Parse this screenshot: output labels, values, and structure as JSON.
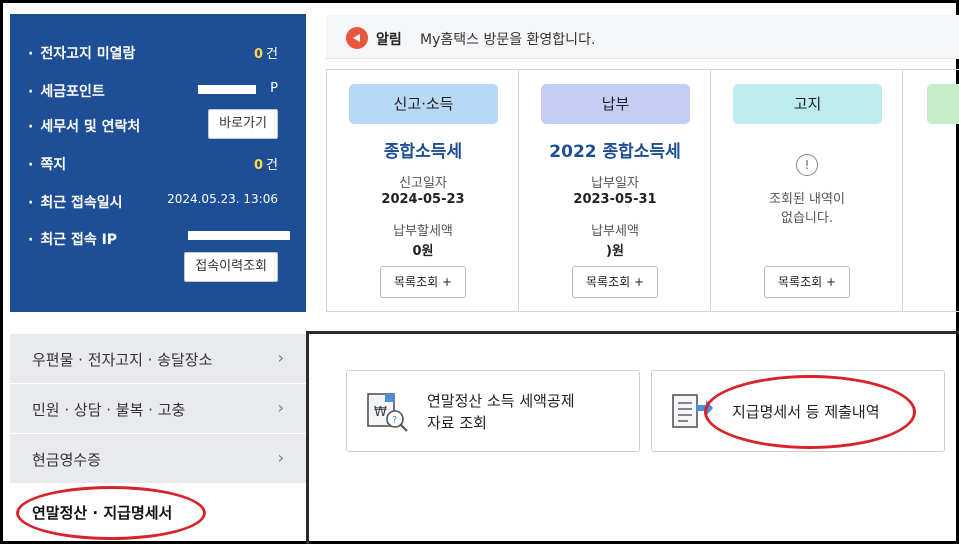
{
  "user_panel": {
    "notices_label": "전자고지 미열람",
    "notices_count": "0",
    "notices_unit": "건",
    "points_label": "세금포인트",
    "points_unit": "P",
    "tax_agent_label": "세무서 및 연락처",
    "shortcut_button": "바로가기",
    "messages_label": "쪽지",
    "messages_count": "0",
    "messages_unit": "건",
    "last_login_label": "최근 접속일시",
    "last_login_value": "2024.05.23.  13:06",
    "last_ip_label": "최근 접속 IP",
    "history_button": "접속이력조회"
  },
  "notice": {
    "label": "알림",
    "text": "My홈택스 방문을 환영합니다."
  },
  "cards": [
    {
      "pill": "신고·소득",
      "pill_color": "#b8d8f5",
      "title": "종합소득세",
      "label1": "신고일자",
      "value1": "2024-05-23",
      "label2": "납부할세액",
      "value2": "0원",
      "button": "목록조회 +"
    },
    {
      "pill": "납부",
      "pill_color": "#c6cdf4",
      "title": "2022 종합소득세",
      "label1": "납부일자",
      "value1": "2023-05-31",
      "label2": "납부세액",
      "value2": ")원",
      "button": "목록조회 +"
    },
    {
      "pill": "고지",
      "pill_color": "#bcecee",
      "empty_icon": "!",
      "empty_line1": "조회된 내역이",
      "empty_line2": "없습니다.",
      "button": "목록조회 +"
    }
  ],
  "fourth_pill_color": "#c5ecc8",
  "menu": [
    {
      "label": "우편물 · 전자고지 · 송달장소",
      "chevron": "›"
    },
    {
      "label": "민원 · 상담 · 불복 · 고충",
      "chevron": "›"
    },
    {
      "label": "현금영수증",
      "chevron": "›"
    },
    {
      "label": "연말정산 · 지급명세서"
    }
  ],
  "services": [
    {
      "line1": "연말정산 소득 세액공제",
      "line2": "자료 조회",
      "icon": "won-document-search-icon"
    },
    {
      "line1": "지급명세서 등 제출내역",
      "icon": "document-submit-icon"
    }
  ],
  "colors": {
    "panel_blue": "#1e4f96",
    "highlight_yellow": "#ffd845",
    "annotation_red": "#d8232a",
    "title_blue": "#1e4f96"
  }
}
